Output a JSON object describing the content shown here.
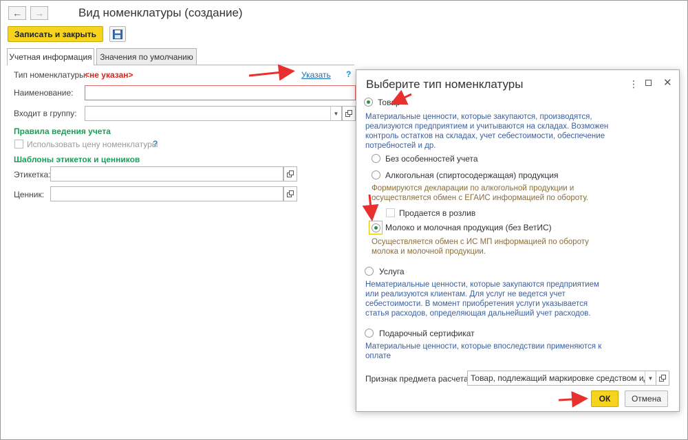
{
  "window": {
    "title": "Вид номенклатуры  (создание)",
    "save_close_label": "Записать и закрыть"
  },
  "tabs": [
    {
      "label": "Учетная информация",
      "active": true
    },
    {
      "label": "Значения по умолчанию",
      "active": false
    }
  ],
  "form": {
    "type_label": "Тип номенклатуры:",
    "type_value": "<не указан>",
    "type_link": "Указать",
    "name_label": "Наименование:",
    "name_value": "",
    "group_label": "Входит в группу:",
    "group_value": "",
    "accounting_section": "Правила ведения учета",
    "use_price_label": "Использовать цену номенклатуры",
    "labels_section": "Шаблоны этикеток и ценников",
    "label_label": "Этикетка:",
    "label_value": "",
    "price_tag_label": "Ценник:",
    "price_tag_value": "",
    "help": "?"
  },
  "dialog": {
    "title": "Выберите тип номенклатуры",
    "options": {
      "goods": {
        "label": "Товар",
        "selected": true,
        "desc": [
          "Материальные ценности, которые закупаются, производятся,",
          "реализуются предприятием и учитываются на складах. Возможен",
          "контроль остатков на складах, учет себестоимости, обеспечение",
          "потребностей и др."
        ]
      },
      "no_features": {
        "label": "Без особенностей учета",
        "selected": false
      },
      "alcohol": {
        "label": "Алкогольная (спиртосодержащая) продукция",
        "selected": false,
        "desc": [
          "Формируются декларации по алкогольной продукции и",
          "осуществляется обмен с ЕГАИС информацией по обороту."
        ]
      },
      "draft": {
        "label": "Продается в розлив"
      },
      "milk": {
        "label": "Молоко и молочная продукция (без ВетИС)",
        "selected": true,
        "desc": [
          "Осуществляется обмен с ИС МП информацией по обороту",
          "молока и молочной продукции."
        ]
      },
      "service": {
        "label": "Услуга",
        "selected": false,
        "desc": [
          "Нематериальные ценности, которые закупаются предприятием",
          "или реализуются клиентам. Для услуг не ведется учет",
          "себестоимости. В момент приобретения услуги указывается",
          "статья расходов, определяющая дальнейший учет расходов."
        ]
      },
      "certificate": {
        "label": "Подарочный сертификат",
        "selected": false,
        "desc": [
          "Материальные ценности, которые впоследствии применяются к",
          "оплате"
        ]
      }
    },
    "payment_subject_label": "Признак предмета расчета:",
    "payment_subject_value": "Товар, подлежащий маркировке средством иде",
    "ok_label": "ОК",
    "cancel_label": "Отмена"
  },
  "colors": {
    "accent_yellow": "#f6d31c",
    "error_red": "#e0201a",
    "section_green": "#1a9e5a",
    "desc_blue": "#3a5f9e",
    "arrow_red": "#e8312f"
  },
  "icons": [
    "back-arrow-icon",
    "forward-arrow-icon",
    "save-disk-icon",
    "dropdown-icon",
    "open-form-icon",
    "more-icon",
    "maximize-icon",
    "close-icon",
    "annotation-arrow"
  ]
}
